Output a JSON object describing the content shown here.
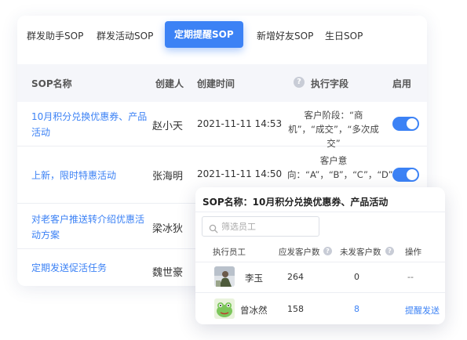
{
  "tabs": [
    {
      "label": "群发助手SOP",
      "active": false
    },
    {
      "label": "群发活动SOP",
      "active": false
    },
    {
      "label": "定期提醒SOP",
      "active": true
    },
    {
      "label": "新增好友SOP",
      "active": false
    },
    {
      "label": "生日SOP",
      "active": false
    }
  ],
  "table": {
    "headers": {
      "name": "SOP名称",
      "creator": "创建人",
      "created_time": "创建时间",
      "exec_field": "执行字段",
      "enabled": "启用"
    },
    "rows": [
      {
        "name": "10月积分兑换优惠券、产品活动",
        "creator": "赵小天",
        "created_time": "2021-11-11 14:53",
        "exec_field": "客户阶段：“商机”，“成交”，“多次成交”",
        "enabled": true
      },
      {
        "name": "上新，限时特惠活动",
        "creator": "张海明",
        "created_time": "2021-11-11 14:50",
        "exec_field": "客户意向：“A”，“B”，“C”，“D”",
        "enabled": true
      },
      {
        "name": "对老客户推送转介绍优惠活动方案",
        "creator": "梁冰狄",
        "created_time": "",
        "exec_field": "",
        "enabled": null
      },
      {
        "name": "定期发送促活任务",
        "creator": "魏世豪",
        "created_time": "",
        "exec_field": "",
        "enabled": null
      }
    ]
  },
  "popup": {
    "title": "SOP名称：10月积分兑换优惠券、产品活动",
    "search_placeholder": "筛选员工",
    "headers": {
      "staff": "执行员工",
      "should_send": "应发客户数",
      "unsent": "未发客户数",
      "action": "操作"
    },
    "rows": [
      {
        "name": "李玉",
        "should_send": "264",
        "unsent": "0",
        "action": "--"
      },
      {
        "name": "曾冰然",
        "should_send": "158",
        "unsent": "8",
        "action": "提醒发送"
      }
    ]
  },
  "colors": {
    "accent": "#3c82f5",
    "header_bg": "#f5f6fa"
  }
}
